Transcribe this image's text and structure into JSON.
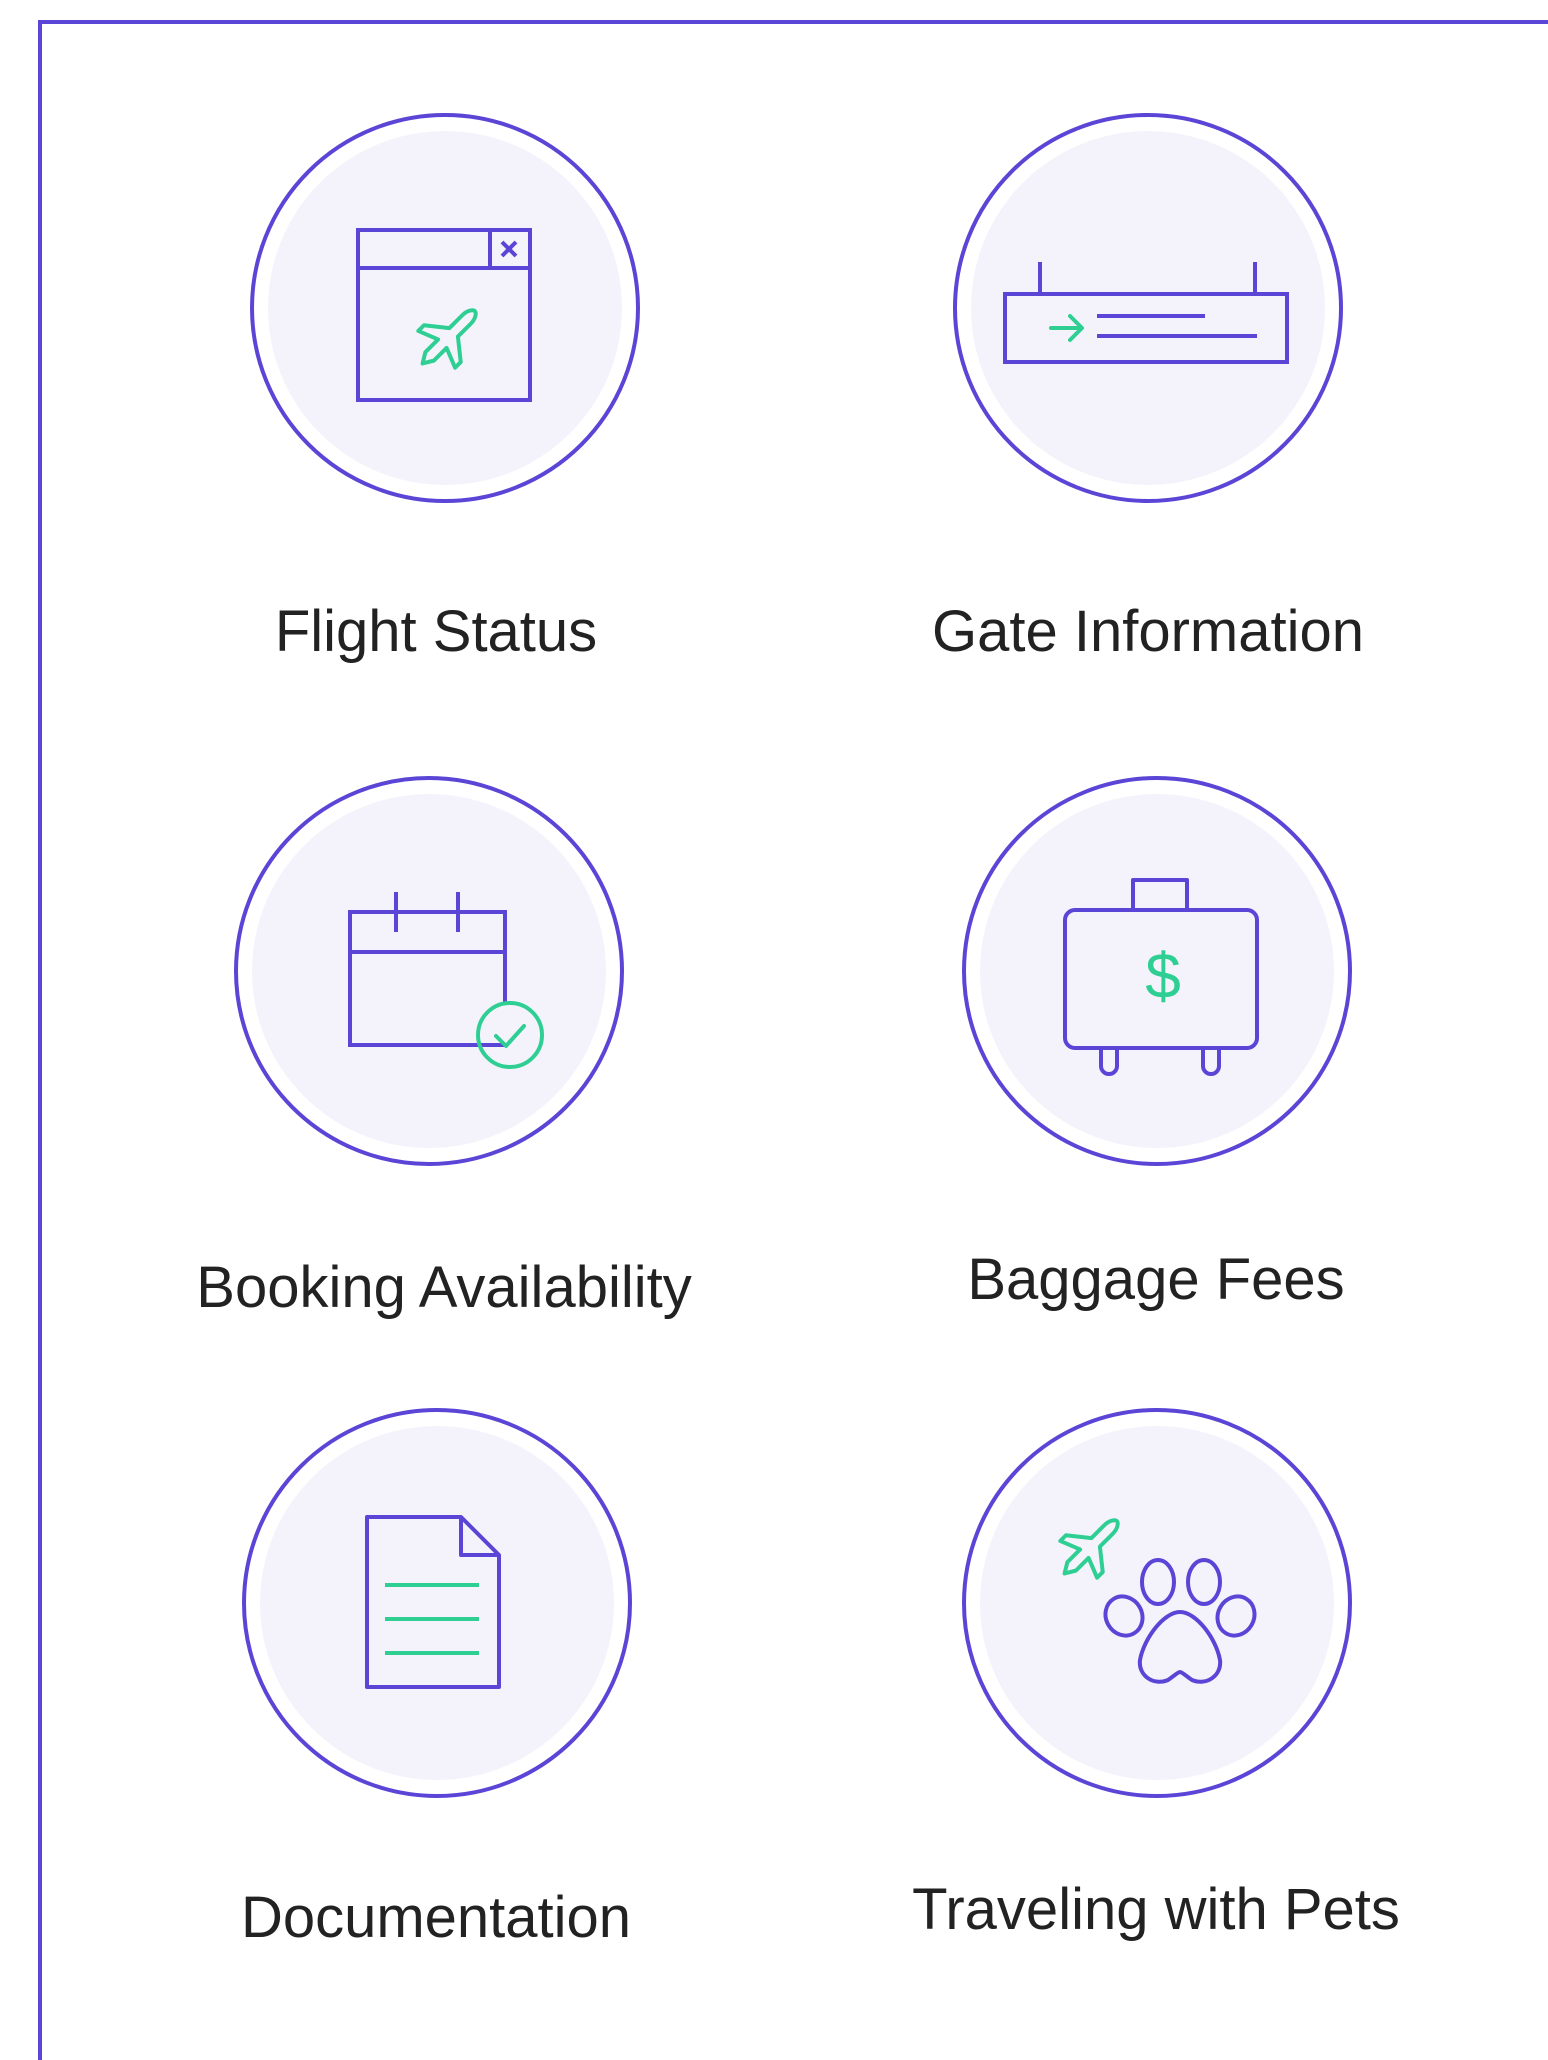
{
  "colors": {
    "accent": "#5a45d6",
    "secondary": "#2fcf94",
    "circle_fill": "#f4f3fc",
    "text": "#222222"
  },
  "items": [
    {
      "label": "Flight Status",
      "icon": "flight-status-icon"
    },
    {
      "label": "Gate Information",
      "icon": "gate-sign-icon"
    },
    {
      "label": "Booking Availability",
      "icon": "calendar-check-icon"
    },
    {
      "label": "Baggage Fees",
      "icon": "suitcase-dollar-icon"
    },
    {
      "label": "Documentation",
      "icon": "document-icon"
    },
    {
      "label": "Traveling with Pets",
      "icon": "paw-airplane-icon"
    }
  ]
}
